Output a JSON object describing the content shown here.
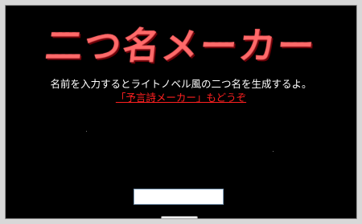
{
  "header": {
    "logo_text": "二つ名メーカー"
  },
  "main": {
    "description": "名前を入力するとライトノベル風の二つ名を生成するよ。",
    "link_text": "「予言詩メーカー」もどうぞ",
    "name_input": {
      "value": "",
      "placeholder": ""
    },
    "submit_label": ""
  },
  "colors": {
    "background": "#000000",
    "logo": "#e0303a",
    "link": "#ff2020",
    "text": "#ffffff"
  }
}
